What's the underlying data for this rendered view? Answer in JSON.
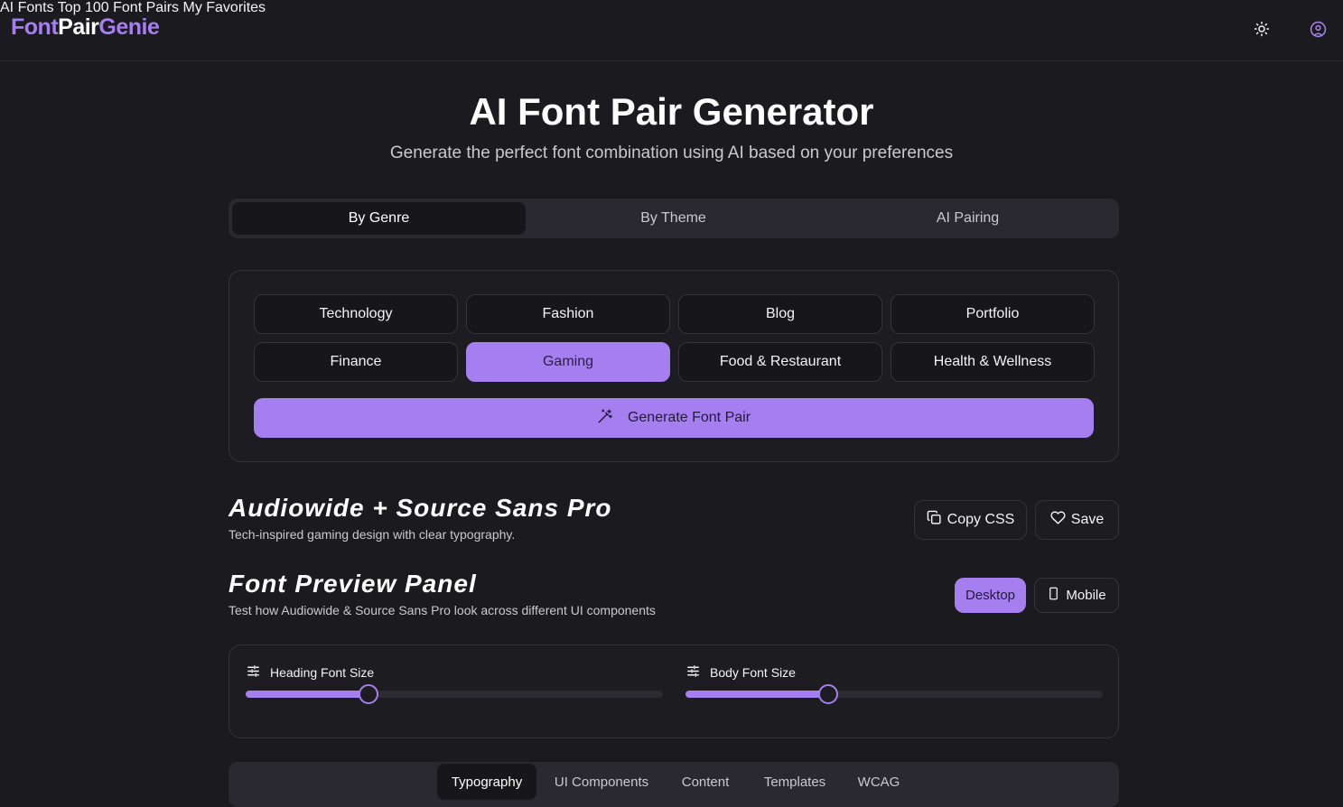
{
  "header": {
    "logo": {
      "part1": "Font",
      "part2": "Pair",
      "part3": "Genie"
    },
    "nav": [
      "AI Fonts",
      "Top 100 Font Pairs",
      "My Favorites"
    ],
    "icons": [
      "sun-icon",
      "user-circle-icon"
    ]
  },
  "hero": {
    "title": "AI Font Pair Generator",
    "subtitle": "Generate the perfect font combination using AI based on your preferences"
  },
  "mode_tabs": {
    "items": [
      "By Genre",
      "By Theme",
      "AI Pairing"
    ],
    "active": "By Genre"
  },
  "genres": {
    "items": [
      "Technology",
      "Fashion",
      "Blog",
      "Portfolio",
      "Finance",
      "Gaming",
      "Food & Restaurant",
      "Health & Wellness"
    ],
    "selected": "Gaming",
    "generate_label": "Generate Font Pair"
  },
  "result": {
    "title": "Audiowide + Source Sans Pro",
    "description": "Tech-inspired gaming design with clear typography.",
    "copy_label": "Copy CSS",
    "save_label": "Save"
  },
  "preview": {
    "title": "Font Preview Panel",
    "description": "Test how Audiowide & Source Sans Pro look across different UI components",
    "devices": [
      "Desktop",
      "Mobile"
    ],
    "active_device": "Desktop"
  },
  "sliders": {
    "heading": {
      "label": "Heading Font Size",
      "fraction": 0.295
    },
    "body": {
      "label": "Body Font Size",
      "fraction": 0.342
    }
  },
  "sub_tabs": {
    "items": [
      "Typography",
      "UI Components",
      "Content",
      "Templates",
      "WCAG"
    ],
    "active": "Typography"
  },
  "colors": {
    "accent": "#a57ef0",
    "background": "#1b1a1f",
    "surface": "#1d1c21"
  }
}
